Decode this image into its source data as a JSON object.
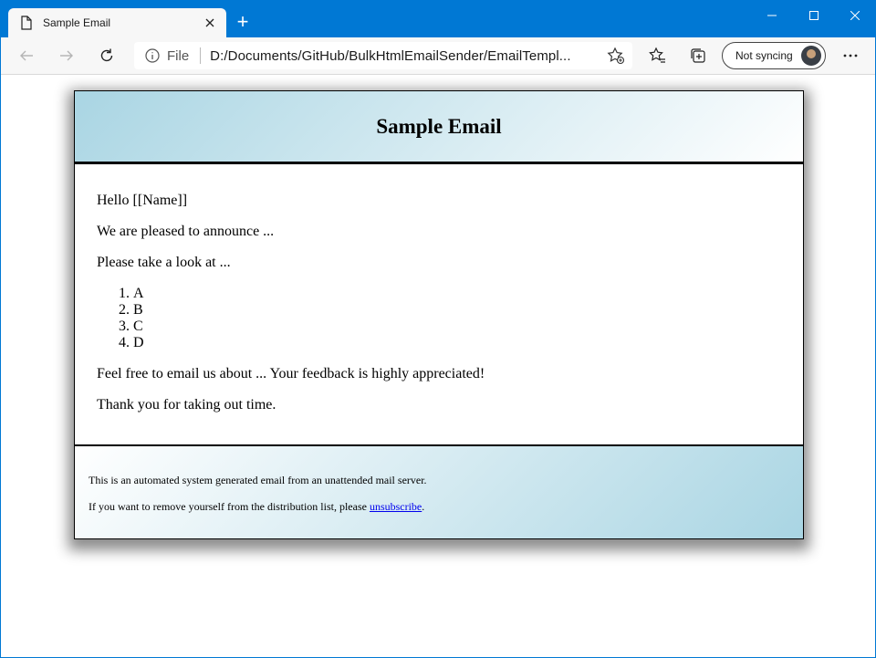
{
  "browser": {
    "tab_title": "Sample Email",
    "new_tab_symbol": "+",
    "address_scheme": "File",
    "address_url": "D:/Documents/GitHub/BulkHtmlEmailSender/EmailTempl...",
    "sync_label": "Not syncing",
    "icons": [
      "page-icon",
      "close-icon",
      "plus-icon",
      "minimize-icon",
      "maximize-icon",
      "window-close-icon",
      "back-icon",
      "forward-icon",
      "refresh-icon",
      "info-icon",
      "add-favorite-icon",
      "favorites-icon",
      "collections-icon",
      "more-icon"
    ]
  },
  "email": {
    "title": "Sample Email",
    "greeting": "Hello [[Name]]",
    "announce": "We are pleased to announce ...",
    "look": "Please take a look at ...",
    "list": [
      "A",
      "B",
      "C",
      "D"
    ],
    "feedback": "Feel free to email us about ... Your feedback is highly appreciated!",
    "thanks": "Thank you for taking out time.",
    "footer_auto": "This is an automated system generated email from an unattended mail server.",
    "footer_remove_prefix": "If you want to remove yourself from the distribution list, please ",
    "unsubscribe_label": "unsubscribe",
    "footer_remove_suffix": "."
  },
  "colors": {
    "titlebar": "#0078d4",
    "toolbar": "#f7f7f7",
    "header_gradient_start": "#a9d5e3",
    "link": "#0000ee"
  }
}
